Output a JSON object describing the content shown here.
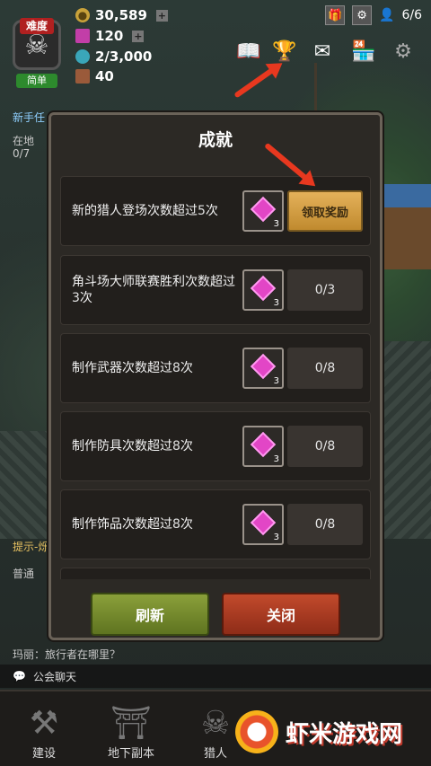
{
  "hud": {
    "difficulty_top": "难度",
    "difficulty_bottom": "简单",
    "gold": "30,589",
    "gems": "120",
    "water": "2/3,000",
    "wood": "40",
    "hunters": "6/6",
    "side_task": "新手任",
    "side_sub": "在地",
    "side_count": "0/7",
    "hint": "提示-烁",
    "chat_tab": "普通",
    "chat_line": "玛丽：旅行者在哪里？"
  },
  "dialog": {
    "title": "成就",
    "rows": [
      {
        "label_pre": "新的猎人登场次数超过",
        "label_num": "5",
        "label_post": "次",
        "reward": "3",
        "claim": "领取奖励"
      },
      {
        "label_pre": "角斗场大师联赛胜利次数超过",
        "label_num": "3",
        "label_post": "次",
        "reward": "3",
        "progress": "0/3"
      },
      {
        "label_pre": "制作武器次数超过",
        "label_num": "8",
        "label_post": "次",
        "reward": "3",
        "progress": "0/8"
      },
      {
        "label_pre": "制作防具次数超过",
        "label_num": "8",
        "label_post": "次",
        "reward": "3",
        "progress": "0/8"
      },
      {
        "label_pre": "制作饰品次数超过",
        "label_num": "8",
        "label_post": "次",
        "reward": "3",
        "progress": "0/8"
      }
    ],
    "refresh_label": "刷新",
    "close_label": "关闭"
  },
  "chat": {
    "label": "公会聊天"
  },
  "nav": {
    "build": "建设",
    "dungeon": "地下副本",
    "hunter": "猎人"
  },
  "watermark": {
    "text": "虾米游戏网"
  },
  "colors": {
    "claim": "#d9a446",
    "refresh": "#728a2a",
    "close": "#a83a22",
    "gem": "#e246c6",
    "arrow": "#e8381f"
  }
}
